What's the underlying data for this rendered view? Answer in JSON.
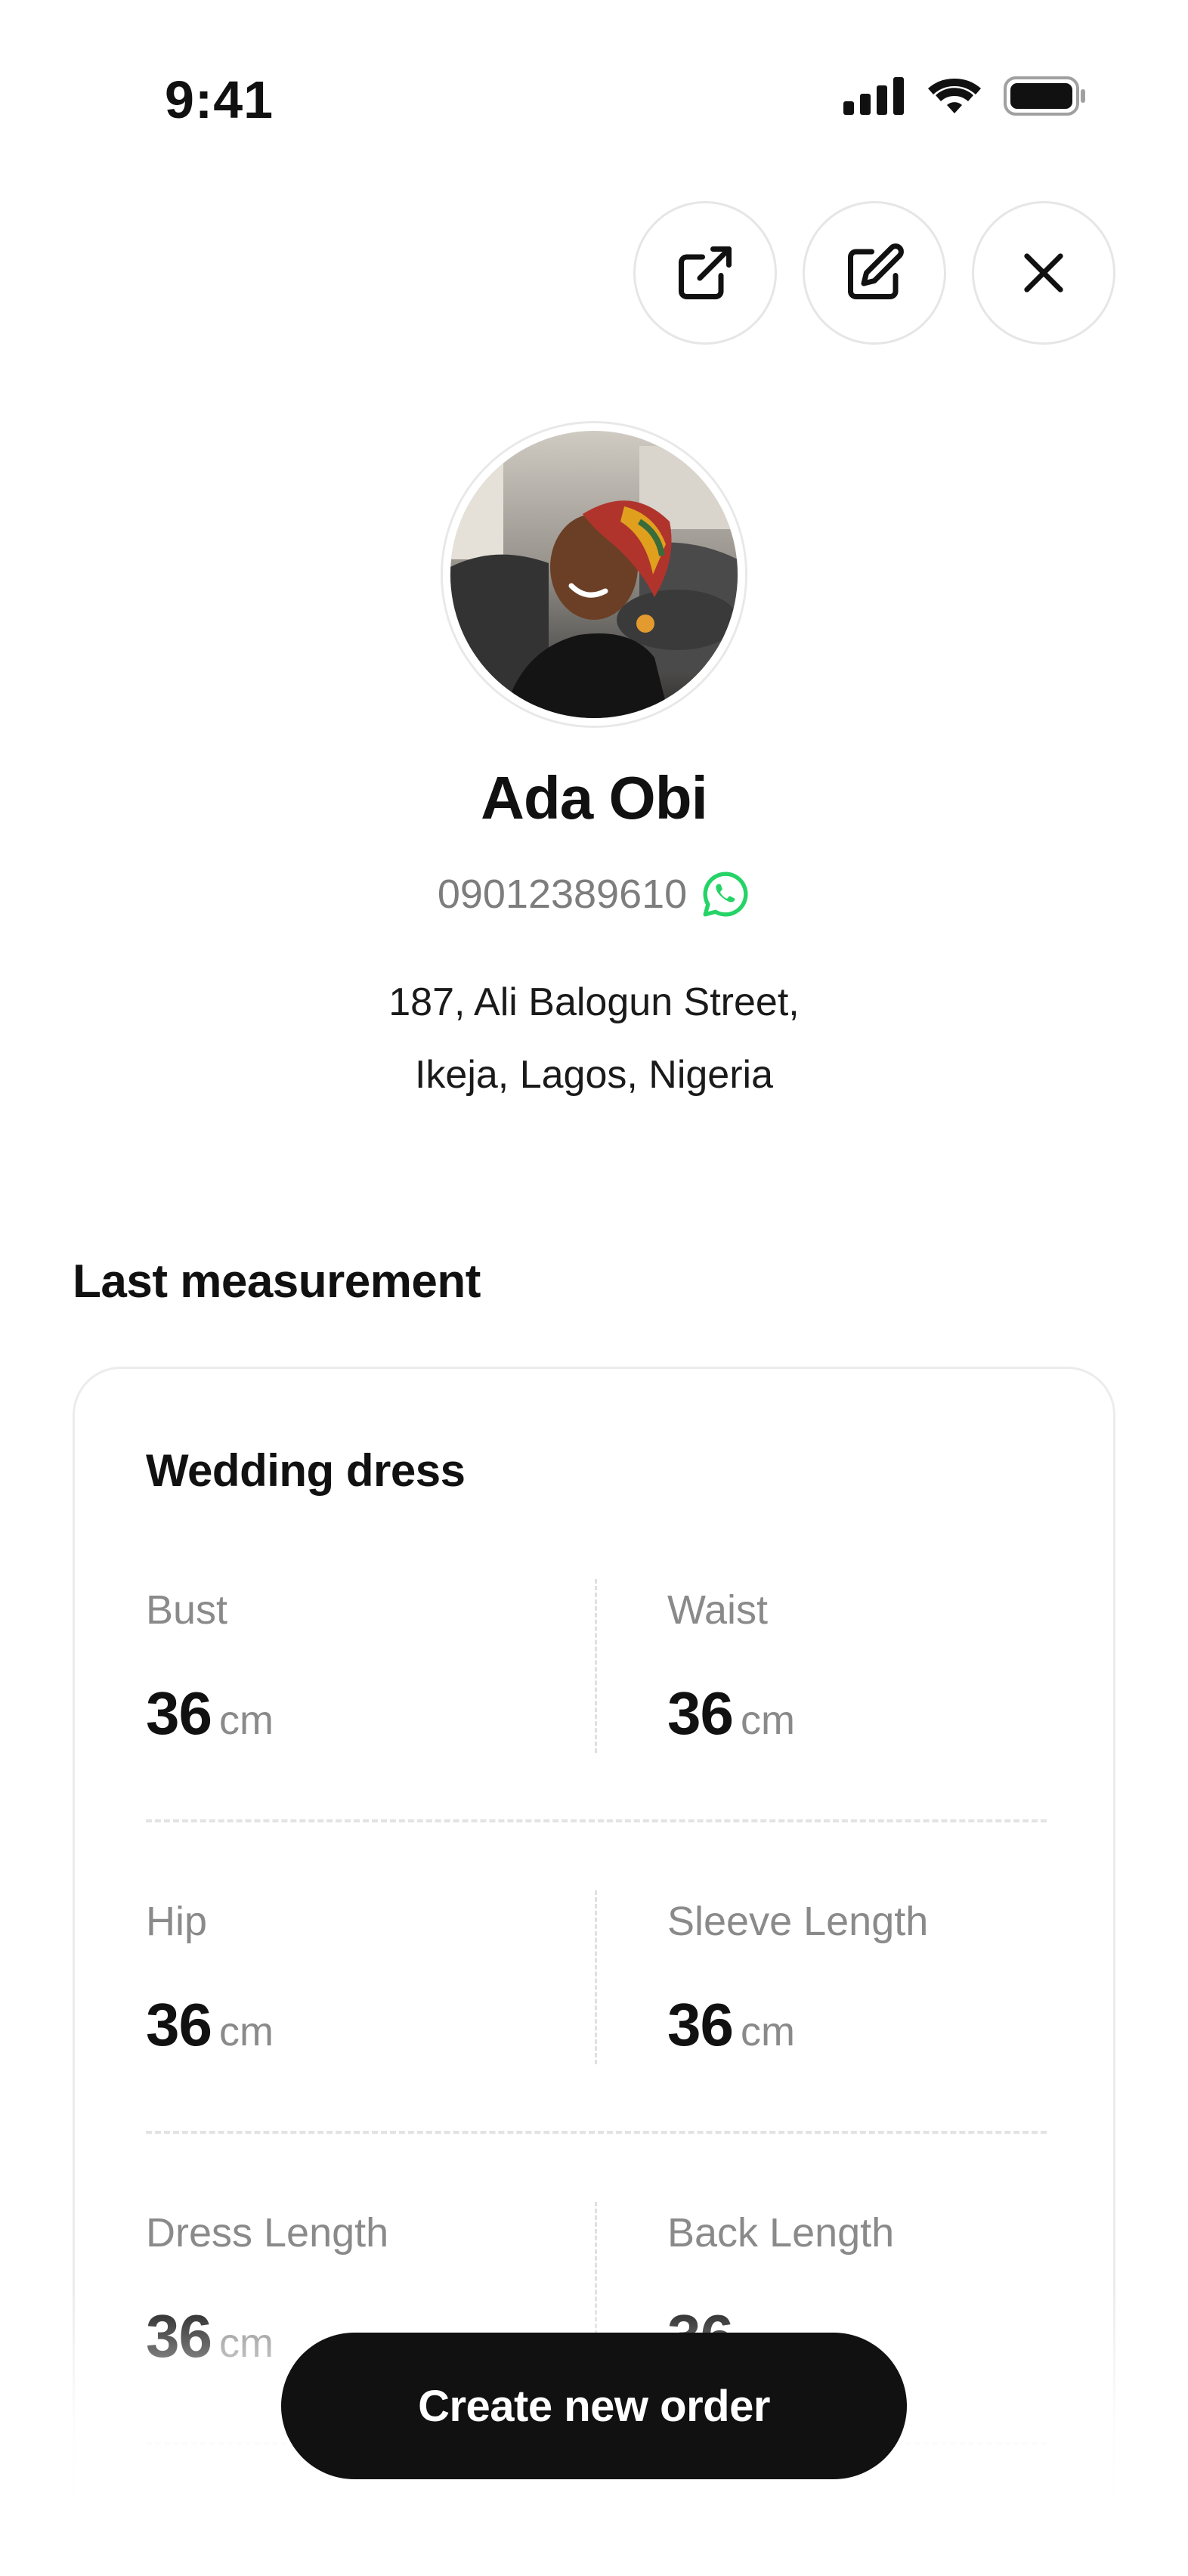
{
  "status_bar": {
    "time": "9:41",
    "icons": [
      "signal-icon",
      "wifi-icon",
      "battery-icon"
    ]
  },
  "actions": [
    {
      "name": "share-button",
      "icon": "external-link-icon"
    },
    {
      "name": "edit-button",
      "icon": "edit-icon"
    },
    {
      "name": "close-button",
      "icon": "close-icon"
    }
  ],
  "profile": {
    "name": "Ada Obi",
    "phone": "09012389610",
    "phone_icon": "whatsapp-icon",
    "address_line1": "187, Ali Balogun Street,",
    "address_line2": "Ikeja, Lagos, Nigeria"
  },
  "section_title": "Last measurement",
  "measurement": {
    "title": "Wedding dress",
    "items": [
      {
        "label": "Bust",
        "value": "36",
        "unit": "cm"
      },
      {
        "label": "Waist",
        "value": "36",
        "unit": "cm"
      },
      {
        "label": "Hip",
        "value": "36",
        "unit": "cm"
      },
      {
        "label": "Sleeve Length",
        "value": "36",
        "unit": "cm"
      },
      {
        "label": "Dress Length",
        "value": "36",
        "unit": "cm"
      },
      {
        "label": "Back Length",
        "value": "36",
        "unit": "cm"
      }
    ]
  },
  "cta": {
    "label": "Create new order"
  },
  "colors": {
    "primary": "#111111",
    "muted": "#8a8a8a",
    "whatsapp": "#25D366"
  }
}
